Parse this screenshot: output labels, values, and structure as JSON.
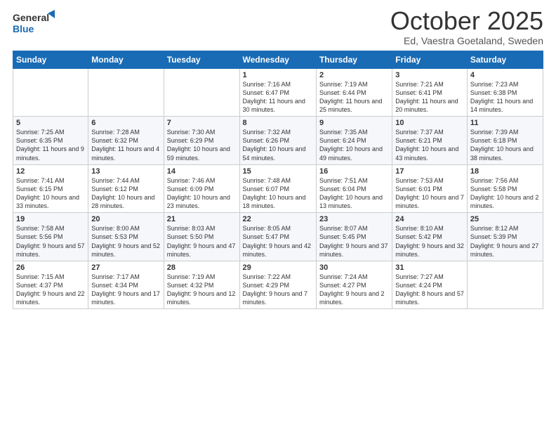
{
  "logo": {
    "general": "General",
    "blue": "Blue"
  },
  "header": {
    "month": "October 2025",
    "location": "Ed, Vaestra Goetaland, Sweden"
  },
  "weekdays": [
    "Sunday",
    "Monday",
    "Tuesday",
    "Wednesday",
    "Thursday",
    "Friday",
    "Saturday"
  ],
  "weeks": [
    [
      {
        "day": "",
        "info": ""
      },
      {
        "day": "",
        "info": ""
      },
      {
        "day": "",
        "info": ""
      },
      {
        "day": "1",
        "info": "Sunrise: 7:16 AM\nSunset: 6:47 PM\nDaylight: 11 hours\nand 30 minutes."
      },
      {
        "day": "2",
        "info": "Sunrise: 7:19 AM\nSunset: 6:44 PM\nDaylight: 11 hours\nand 25 minutes."
      },
      {
        "day": "3",
        "info": "Sunrise: 7:21 AM\nSunset: 6:41 PM\nDaylight: 11 hours\nand 20 minutes."
      },
      {
        "day": "4",
        "info": "Sunrise: 7:23 AM\nSunset: 6:38 PM\nDaylight: 11 hours\nand 14 minutes."
      }
    ],
    [
      {
        "day": "5",
        "info": "Sunrise: 7:25 AM\nSunset: 6:35 PM\nDaylight: 11 hours\nand 9 minutes."
      },
      {
        "day": "6",
        "info": "Sunrise: 7:28 AM\nSunset: 6:32 PM\nDaylight: 11 hours\nand 4 minutes."
      },
      {
        "day": "7",
        "info": "Sunrise: 7:30 AM\nSunset: 6:29 PM\nDaylight: 10 hours\nand 59 minutes."
      },
      {
        "day": "8",
        "info": "Sunrise: 7:32 AM\nSunset: 6:26 PM\nDaylight: 10 hours\nand 54 minutes."
      },
      {
        "day": "9",
        "info": "Sunrise: 7:35 AM\nSunset: 6:24 PM\nDaylight: 10 hours\nand 49 minutes."
      },
      {
        "day": "10",
        "info": "Sunrise: 7:37 AM\nSunset: 6:21 PM\nDaylight: 10 hours\nand 43 minutes."
      },
      {
        "day": "11",
        "info": "Sunrise: 7:39 AM\nSunset: 6:18 PM\nDaylight: 10 hours\nand 38 minutes."
      }
    ],
    [
      {
        "day": "12",
        "info": "Sunrise: 7:41 AM\nSunset: 6:15 PM\nDaylight: 10 hours\nand 33 minutes."
      },
      {
        "day": "13",
        "info": "Sunrise: 7:44 AM\nSunset: 6:12 PM\nDaylight: 10 hours\nand 28 minutes."
      },
      {
        "day": "14",
        "info": "Sunrise: 7:46 AM\nSunset: 6:09 PM\nDaylight: 10 hours\nand 23 minutes."
      },
      {
        "day": "15",
        "info": "Sunrise: 7:48 AM\nSunset: 6:07 PM\nDaylight: 10 hours\nand 18 minutes."
      },
      {
        "day": "16",
        "info": "Sunrise: 7:51 AM\nSunset: 6:04 PM\nDaylight: 10 hours\nand 13 minutes."
      },
      {
        "day": "17",
        "info": "Sunrise: 7:53 AM\nSunset: 6:01 PM\nDaylight: 10 hours\nand 7 minutes."
      },
      {
        "day": "18",
        "info": "Sunrise: 7:56 AM\nSunset: 5:58 PM\nDaylight: 10 hours\nand 2 minutes."
      }
    ],
    [
      {
        "day": "19",
        "info": "Sunrise: 7:58 AM\nSunset: 5:56 PM\nDaylight: 9 hours\nand 57 minutes."
      },
      {
        "day": "20",
        "info": "Sunrise: 8:00 AM\nSunset: 5:53 PM\nDaylight: 9 hours\nand 52 minutes."
      },
      {
        "day": "21",
        "info": "Sunrise: 8:03 AM\nSunset: 5:50 PM\nDaylight: 9 hours\nand 47 minutes."
      },
      {
        "day": "22",
        "info": "Sunrise: 8:05 AM\nSunset: 5:47 PM\nDaylight: 9 hours\nand 42 minutes."
      },
      {
        "day": "23",
        "info": "Sunrise: 8:07 AM\nSunset: 5:45 PM\nDaylight: 9 hours\nand 37 minutes."
      },
      {
        "day": "24",
        "info": "Sunrise: 8:10 AM\nSunset: 5:42 PM\nDaylight: 9 hours\nand 32 minutes."
      },
      {
        "day": "25",
        "info": "Sunrise: 8:12 AM\nSunset: 5:39 PM\nDaylight: 9 hours\nand 27 minutes."
      }
    ],
    [
      {
        "day": "26",
        "info": "Sunrise: 7:15 AM\nSunset: 4:37 PM\nDaylight: 9 hours\nand 22 minutes."
      },
      {
        "day": "27",
        "info": "Sunrise: 7:17 AM\nSunset: 4:34 PM\nDaylight: 9 hours\nand 17 minutes."
      },
      {
        "day": "28",
        "info": "Sunrise: 7:19 AM\nSunset: 4:32 PM\nDaylight: 9 hours\nand 12 minutes."
      },
      {
        "day": "29",
        "info": "Sunrise: 7:22 AM\nSunset: 4:29 PM\nDaylight: 9 hours\nand 7 minutes."
      },
      {
        "day": "30",
        "info": "Sunrise: 7:24 AM\nSunset: 4:27 PM\nDaylight: 9 hours\nand 2 minutes."
      },
      {
        "day": "31",
        "info": "Sunrise: 7:27 AM\nSunset: 4:24 PM\nDaylight: 8 hours\nand 57 minutes."
      },
      {
        "day": "",
        "info": ""
      }
    ]
  ]
}
